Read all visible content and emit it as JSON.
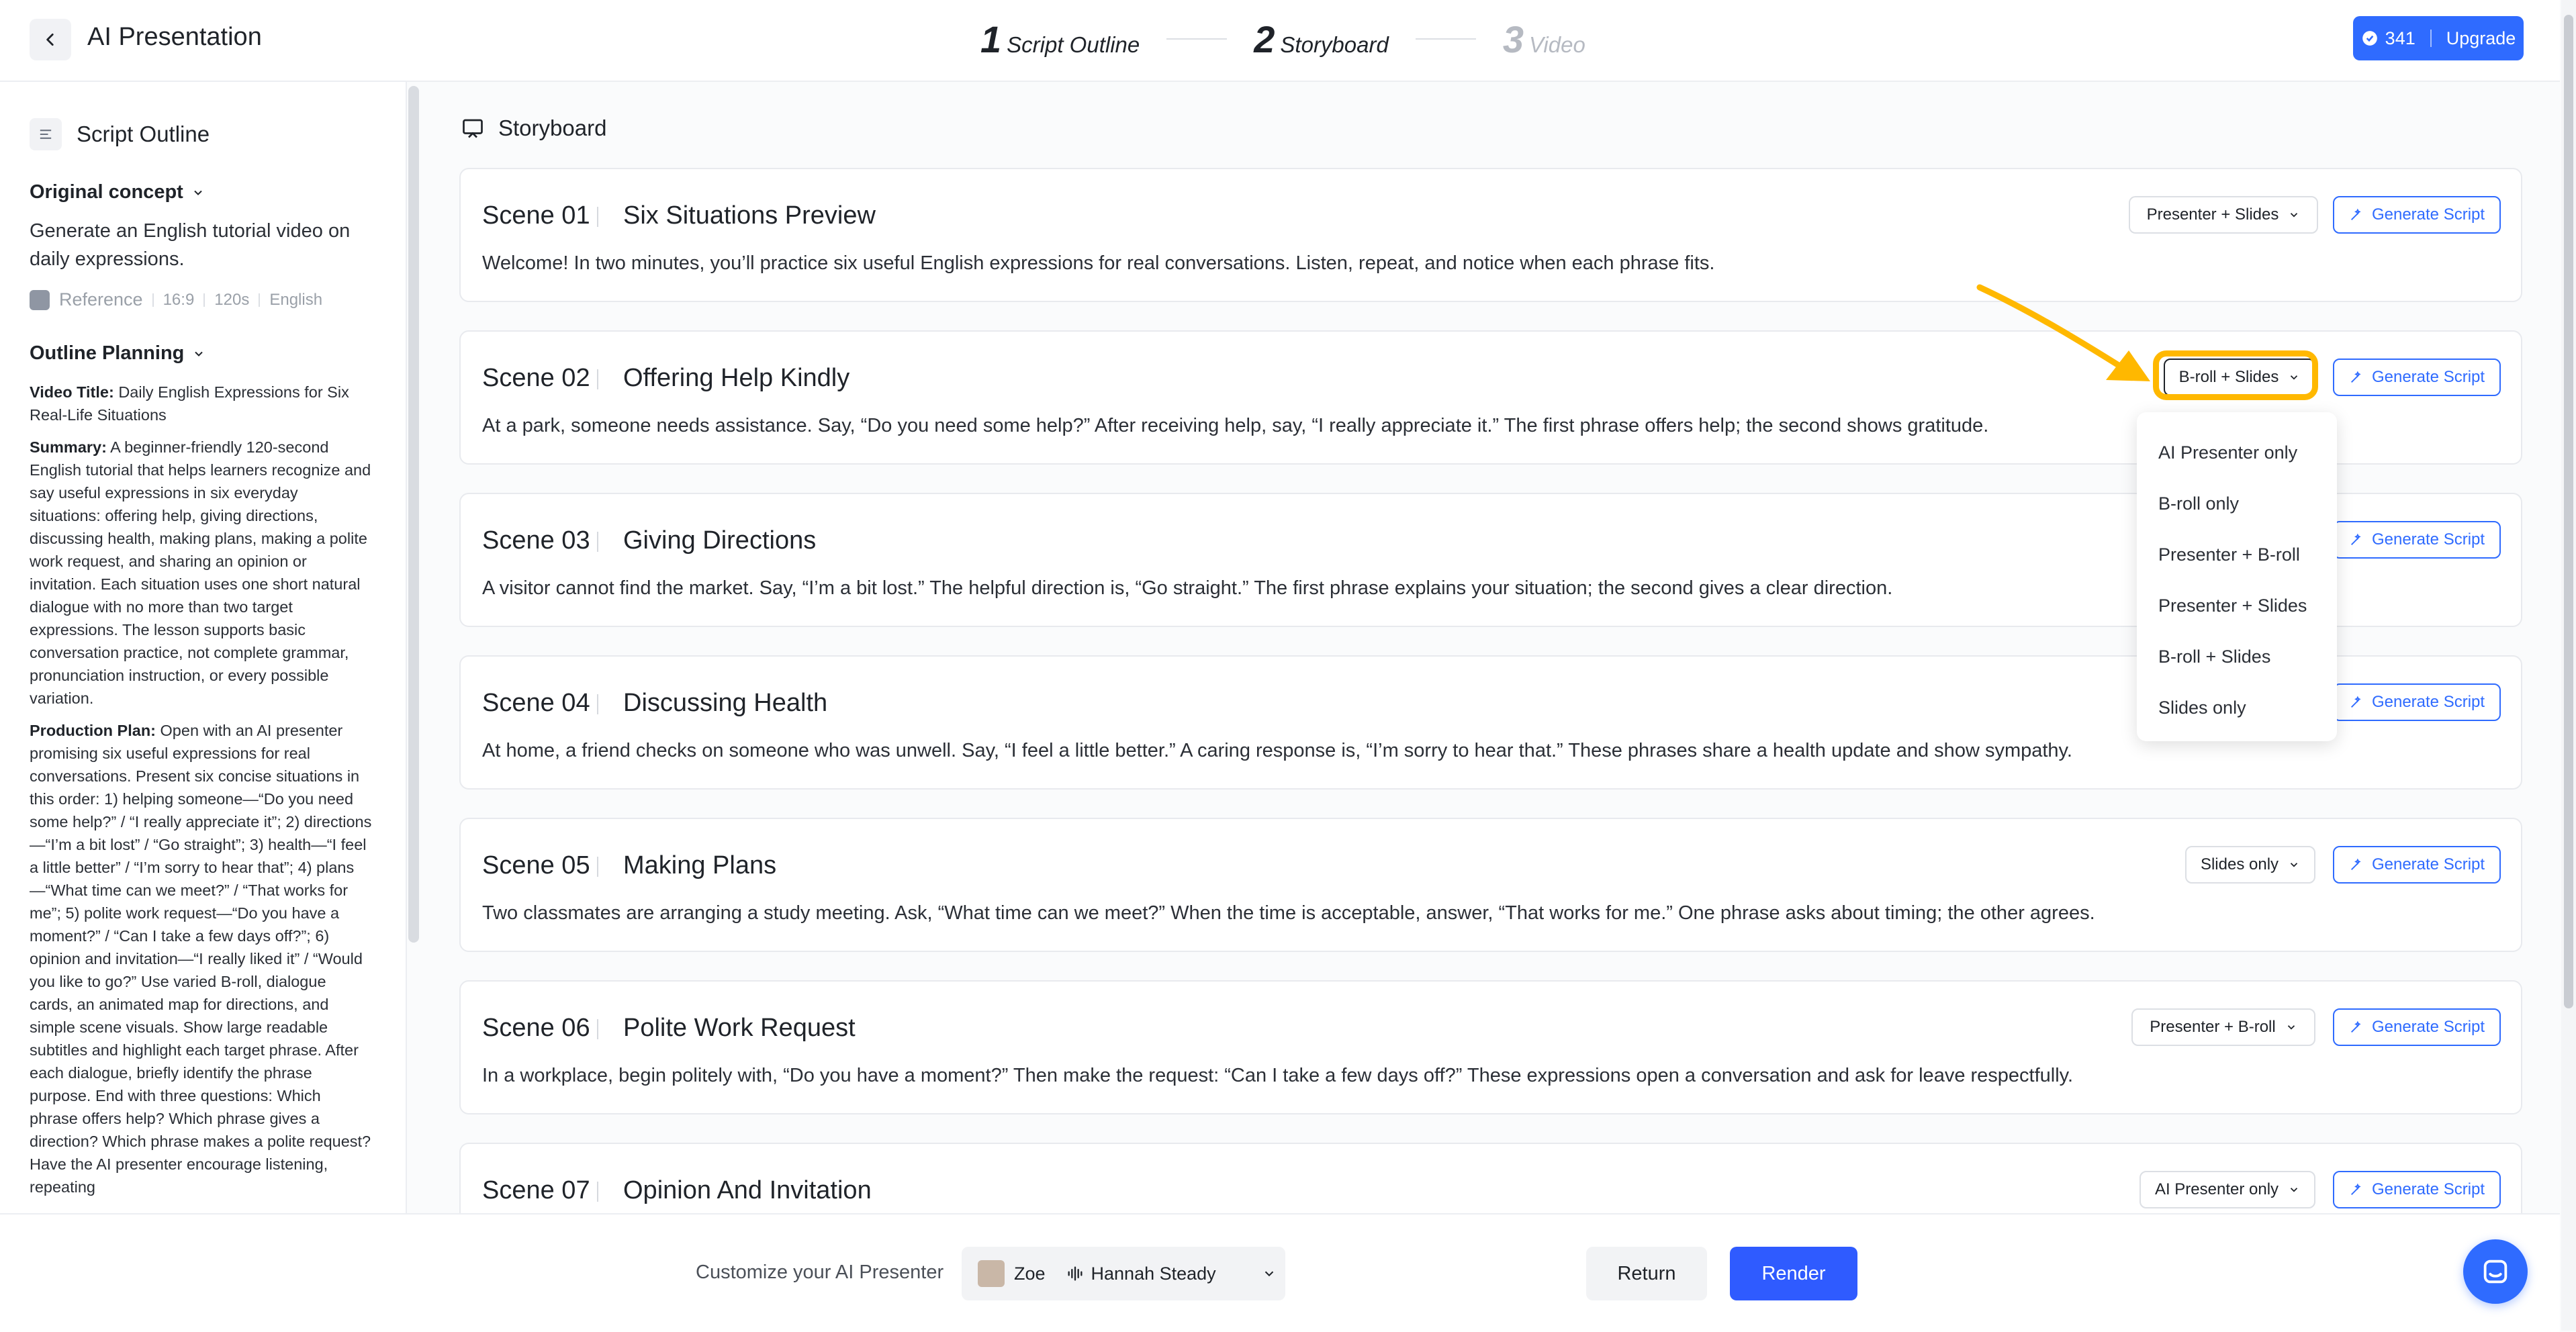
{
  "header": {
    "app_title": "AI Presentation",
    "steps": [
      {
        "num": "1",
        "label": "Script Outline"
      },
      {
        "num": "2",
        "label": "Storyboard"
      },
      {
        "num": "3",
        "label": "Video"
      }
    ],
    "credits": "341",
    "upgrade_label": "Upgrade"
  },
  "sidebar": {
    "title": "Script Outline",
    "original_concept_label": "Original concept",
    "concept_text": "Generate an English tutorial video on daily expressions.",
    "meta": {
      "reference": "Reference",
      "ratio": "16:9",
      "duration": "120s",
      "language": "English"
    },
    "outline_label": "Outline Planning",
    "video_title_label": "Video Title:",
    "video_title": "Daily English Expressions for Six Real-Life Situations",
    "summary_label": "Summary:",
    "summary": "A beginner-friendly 120-second English tutorial that helps learners recognize and say useful expressions in six everyday situations: offering help, giving directions, discussing health, making plans, making a polite work request, and sharing an opinion or invitation. Each situation uses one short natural dialogue with no more than two target expressions. The lesson supports basic conversation practice, not complete grammar, pronunciation instruction, or every possible variation.",
    "production_label": "Production Plan:",
    "production": "Open with an AI presenter promising six useful expressions for real conversations. Present six concise situations in this order: 1) helping someone—“Do you need some help?” / “I really appreciate it”; 2) directions—“I’m a bit lost” / “Go straight”; 3) health—“I feel a little better” / “I’m sorry to hear that”; 4) plans—“What time can we meet?” / “That works for me”; 5) polite work request—“Do you have a moment?” / “Can I take a few days off?”; 6) opinion and invitation—“I really liked it” / “Would you like to go?” Use varied B-roll, dialogue cards, an animated map for directions, and simple scene visuals. Show large readable subtitles and highlight each target phrase. After each dialogue, briefly identify the phrase purpose. End with three questions: Which phrase offers help? Which phrase gives a direction? Which phrase makes a polite request? Have the AI presenter encourage listening, repeating"
  },
  "main": {
    "title": "Storyboard",
    "generate_label": "Generate Script",
    "scenes": [
      {
        "num": "Scene 01",
        "title": "Six Situations Preview",
        "layout": "Presenter + Slides",
        "desc": "Welcome! In two minutes, you’ll practice six useful English expressions for real conversations. Listen, repeat, and notice when each phrase fits."
      },
      {
        "num": "Scene 02",
        "title": "Offering Help Kindly",
        "layout": "B-roll + Slides",
        "desc": "At a park, someone needs assistance. Say, “Do you need some help?” After receiving help, say, “I really appreciate it.” The first phrase offers help; the second shows gratitude."
      },
      {
        "num": "Scene 03",
        "title": "Giving Directions",
        "layout": "",
        "desc": "A visitor cannot find the market. Say, “I’m a bit lost.” The helpful direction is, “Go straight.” The first phrase explains your situation; the second gives a clear direction."
      },
      {
        "num": "Scene 04",
        "title": "Discussing Health",
        "layout": "",
        "desc": "At home, a friend checks on someone who was unwell. Say, “I feel a little better.” A caring response is, “I’m sorry to hear that.” These phrases share a health update and show sympathy."
      },
      {
        "num": "Scene 05",
        "title": "Making Plans",
        "layout": "Slides only",
        "desc": "Two classmates are arranging a study meeting. Ask, “What time can we meet?” When the time is acceptable, answer, “That works for me.” One phrase asks about timing; the other agrees."
      },
      {
        "num": "Scene 06",
        "title": "Polite Work Request",
        "layout": "Presenter + B-roll",
        "desc": "In a workplace, begin politely with, “Do you have a moment?” Then make the request: “Can I take a few days off?” These expressions open a conversation and ask for leave respectfully."
      },
      {
        "num": "Scene 07",
        "title": "Opinion And Invitation",
        "layout": "AI Presenter only",
        "desc": ""
      }
    ],
    "dropdown_options": [
      "AI Presenter only",
      "B-roll only",
      "Presenter + B-roll",
      "Presenter + Slides",
      "B-roll + Slides",
      "Slides only"
    ]
  },
  "footer": {
    "customize_label": "Customize your AI Presenter",
    "presenter_name": "Zoe",
    "voice_name": "Hannah Steady",
    "return_label": "Return",
    "render_label": "Render"
  },
  "colors": {
    "accent": "#2f6bff",
    "highlight": "#ffb800"
  }
}
